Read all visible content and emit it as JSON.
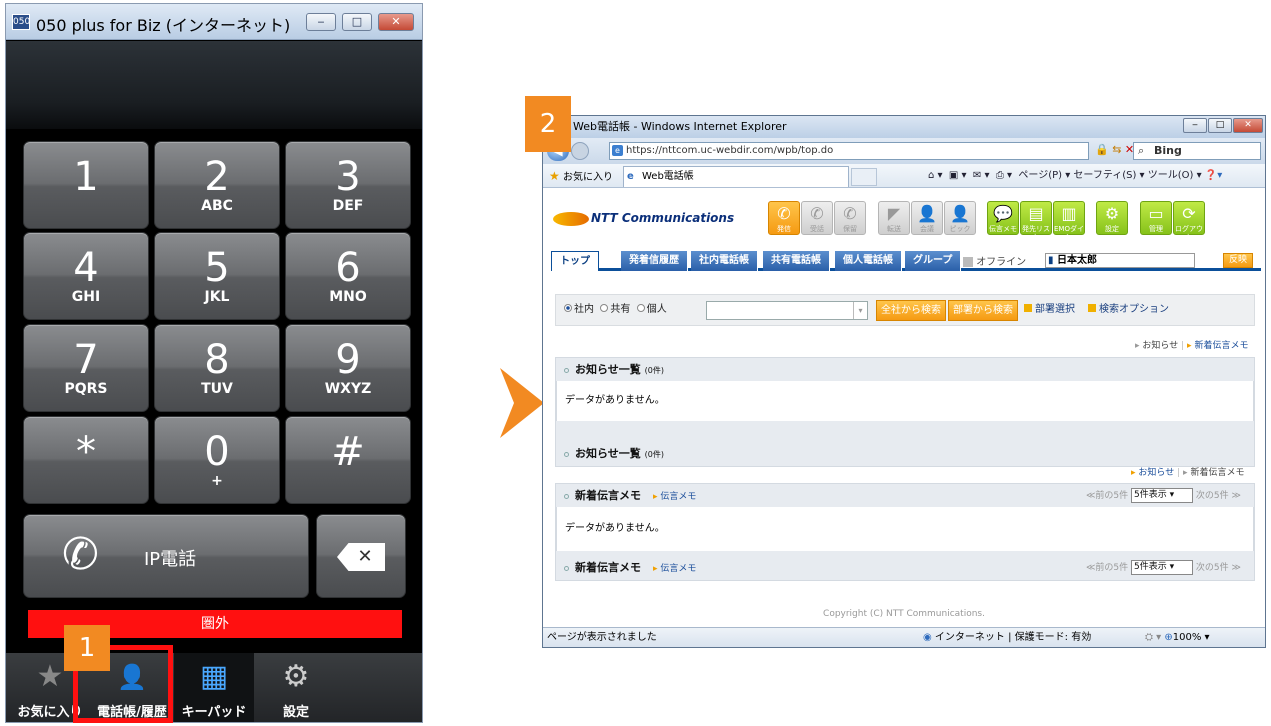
{
  "phone": {
    "title": "050 plus for Biz (インターネット)",
    "app_icon": "050",
    "window_buttons": [
      "‒",
      "□",
      "✕"
    ],
    "keys": [
      {
        "digit": "1",
        "letters": ""
      },
      {
        "digit": "2",
        "letters": "ABC"
      },
      {
        "digit": "3",
        "letters": "DEF"
      },
      {
        "digit": "4",
        "letters": "GHI"
      },
      {
        "digit": "5",
        "letters": "JKL"
      },
      {
        "digit": "6",
        "letters": "MNO"
      },
      {
        "digit": "7",
        "letters": "PQRS"
      },
      {
        "digit": "8",
        "letters": "TUV"
      },
      {
        "digit": "9",
        "letters": "WXYZ"
      },
      {
        "digit": "*",
        "letters": ""
      },
      {
        "digit": "0",
        "letters": "+"
      },
      {
        "digit": "#",
        "letters": ""
      }
    ],
    "call_label": "IP電話",
    "call_icon": "phone-handset-icon",
    "backspace_icon": "backspace-icon",
    "status_text": "圏外",
    "status_color": "#ff1010",
    "tabs": [
      {
        "label": "お気に入り",
        "icon": "star-icon",
        "glyph": "★"
      },
      {
        "label": "電話帳/履歴",
        "icon": "contacts-icon",
        "glyph": "👤"
      },
      {
        "label": "キーパッド",
        "icon": "keypad-icon",
        "glyph": "▦"
      },
      {
        "label": "設定",
        "icon": "gear-icon",
        "glyph": "⚙"
      }
    ],
    "tab_active": "キーパッド"
  },
  "callouts": {
    "one": "1",
    "two": "2",
    "color": "#f28a22"
  },
  "browser": {
    "title": "Web電話帳 - Windows Internet Explorer",
    "window_buttons": [
      "‒",
      "□",
      "✕"
    ],
    "url": "https://nttcom.uc-webdir.com/wpb/top.do",
    "search_engine": "Bing",
    "favorites_label": "お気に入り",
    "tab_label": "Web電話帳",
    "command_bar": "ページ(P) ▾  セーフティ(S) ▾  ツール(O) ▾",
    "status_left": "ページが表示されました",
    "status_zone": "インターネット | 保護モード: 有効",
    "zoom": "100%"
  },
  "app": {
    "logo": "NTT Communications",
    "actions": [
      {
        "label": "発信",
        "style": "o"
      },
      {
        "label": "受話",
        "style": "gr"
      },
      {
        "label": "保留",
        "style": "gr"
      },
      {
        "label": "転送",
        "style": "gr"
      },
      {
        "label": "会議",
        "style": "gr"
      },
      {
        "label": "ピック",
        "style": "gr"
      },
      {
        "label": "伝言メモ",
        "style": "gn"
      },
      {
        "label": "発先リスト",
        "style": "gn"
      },
      {
        "label": "EMOダイン",
        "style": "gn"
      },
      {
        "label": "設定",
        "style": "gn"
      },
      {
        "label": "管理",
        "style": "gn"
      },
      {
        "label": "ログアウト",
        "style": "gn"
      }
    ],
    "tabs": [
      "トップ",
      "発着信履歴",
      "社内電話帳",
      "共有電話帳",
      "個人電話帳",
      "グループ"
    ],
    "offline_label": "オフライン",
    "user_name": "日本太郎",
    "reflect_button": "反映",
    "search": {
      "radios": [
        "社内",
        "共有",
        "個人"
      ],
      "selected_radio": "社内",
      "btn_all": "全社から検索",
      "btn_dept": "部署から検索",
      "link_dept": "部署選択",
      "link_options": "検索オプション"
    },
    "sublinks1": {
      "a": "お知らせ",
      "b": "新着伝言メモ"
    },
    "notice_panel": {
      "title": "お知らせ一覧",
      "count": "(0件)",
      "empty": "データがありません。"
    },
    "sublinks2": {
      "a": "お知らせ",
      "b": "新着伝言メモ"
    },
    "memo_panel": {
      "title": "新着伝言メモ",
      "link": "伝言メモ",
      "prev": "≪前の5件",
      "per_page": "5件表示",
      "next": "次の5件 ≫",
      "empty": "データがありません。"
    },
    "copyright": "Copyright (C) NTT Communications."
  }
}
